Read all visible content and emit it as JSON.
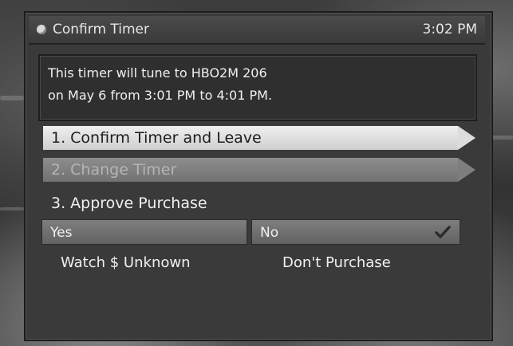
{
  "dialog": {
    "title": "Confirm Timer",
    "clock": "3:02 PM",
    "message": {
      "line1": "This timer will tune to HBO2M 206",
      "line2": "on May 6 from 3:01 PM to 4:01 PM."
    },
    "menu": [
      {
        "label": "1. Confirm Timer and Leave",
        "state": "selected"
      },
      {
        "label": "2. Change Timer",
        "state": "disabled"
      },
      {
        "label": "3. Approve Purchase",
        "state": "normal"
      }
    ],
    "purchase_choice": {
      "yes_label": "Yes",
      "no_label": "No",
      "selected": "No",
      "yes_description": "Watch $ Unknown",
      "no_description": "Don't Purchase"
    }
  },
  "icons": {
    "title": "circle-bullet-icon",
    "selected_choice": "checkmark-icon",
    "menu_arrow": "triangle-right-icon"
  },
  "colors": {
    "dialog_bg": "#3a3a3a",
    "selected_item": "#e0e0e0",
    "disabled_item": "#7e7e7e",
    "choice_bg": "#6f6f6f",
    "text": "#f0f0f0"
  }
}
